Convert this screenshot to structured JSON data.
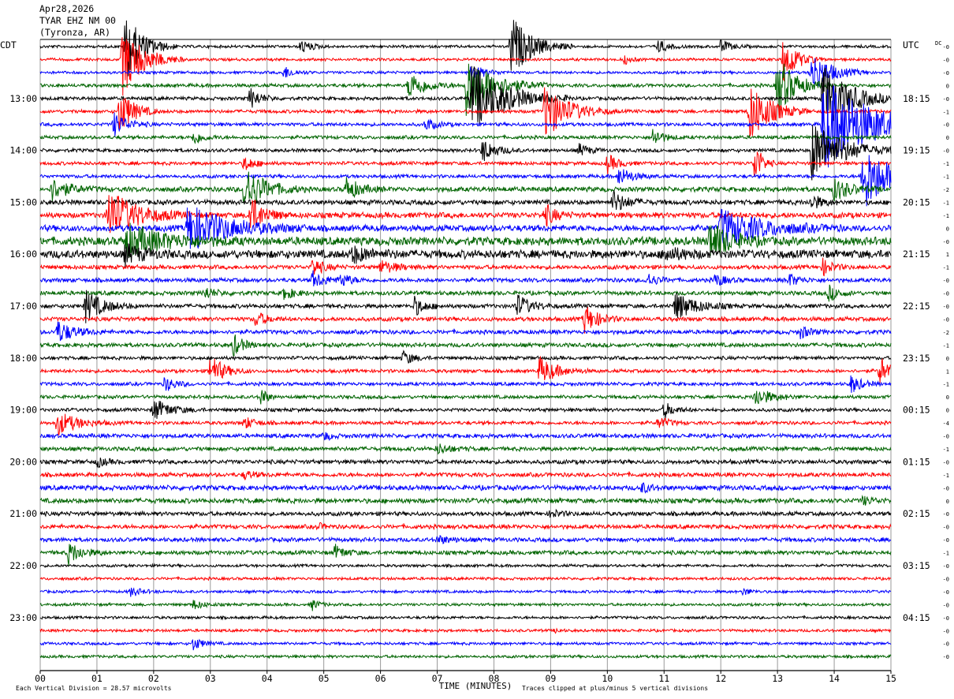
{
  "header": {
    "date": "Apr28,2026",
    "station": "TYAR EHZ NM 00",
    "location": "(Tyronza, AR)"
  },
  "chart_data": {
    "type": "line",
    "left_timezone": "CDT",
    "right_timezone": "UTC",
    "xlabel": "TIME (MINUTES)",
    "xlim": [
      0,
      15
    ],
    "x_ticks": [
      "00",
      "01",
      "02",
      "03",
      "04",
      "05",
      "06",
      "07",
      "08",
      "09",
      "10",
      "11",
      "12",
      "13",
      "14",
      "15"
    ],
    "trace_minutes": 15,
    "trace_count": 48,
    "trace_colors": [
      "#000000",
      "#ff0000",
      "#0000ff",
      "#006400"
    ],
    "cdt_labels": [
      "13:00",
      "14:00",
      "15:00",
      "16:00",
      "17:00",
      "18:00",
      "19:00",
      "20:00",
      "21:00",
      "22:00",
      "23:00"
    ],
    "cdt_label_rows": [
      4,
      8,
      12,
      16,
      20,
      24,
      28,
      32,
      36,
      40,
      44
    ],
    "utc_labels": [
      "18:15",
      "19:15",
      "20:15",
      "21:15",
      "22:15",
      "23:15",
      "00:15",
      "01:15",
      "02:15",
      "03:15",
      "04:15"
    ],
    "utc_label_rows": [
      4,
      8,
      12,
      16,
      20,
      24,
      28,
      32,
      36,
      40,
      44
    ],
    "dc_label": "DC",
    "dc_offsets": [
      "-0",
      "-0",
      "-0",
      "0",
      "-0",
      "-1",
      "-0",
      "0",
      "-0",
      "-1",
      "-1",
      "-2",
      "-1",
      "-1",
      "0",
      "-0",
      "1",
      "-1",
      "-0",
      "-0",
      "-0",
      "-0",
      "-2",
      "-1",
      "0",
      "1",
      "-1",
      "0",
      "0",
      "-4",
      "-0",
      "-1",
      "-0",
      "-1",
      "-0",
      "0",
      "-0",
      "-0",
      "-0",
      "-1",
      "-0",
      "-0",
      "-0",
      "-0",
      "-0",
      "-0",
      "-0",
      "-0"
    ],
    "trace_noise": [
      2,
      2,
      2,
      2.5,
      2.5,
      2.5,
      2.5,
      2.5,
      2.5,
      2.5,
      2.5,
      3.5,
      3.5,
      4,
      4.5,
      6,
      6,
      3,
      3,
      3,
      3,
      3,
      3,
      3,
      2.5,
      2.5,
      2.5,
      2.5,
      2.5,
      2.5,
      3,
      3,
      3,
      3,
      3.5,
      3.5,
      3,
      3,
      3,
      3,
      2,
      2,
      2,
      2,
      2,
      2,
      2,
      2
    ],
    "events": [
      {
        "row": 0,
        "minute": 1.5,
        "amplitude": 45,
        "duration": 0.5
      },
      {
        "row": 0,
        "minute": 4.6,
        "amplitude": 9,
        "duration": 0.3
      },
      {
        "row": 0,
        "minute": 8.3,
        "amplitude": 40,
        "duration": 0.6
      },
      {
        "row": 0,
        "minute": 10.9,
        "amplitude": 8,
        "duration": 0.3
      },
      {
        "row": 0,
        "minute": 12.0,
        "amplitude": 8,
        "duration": 0.3
      },
      {
        "row": 1,
        "minute": 1.45,
        "amplitude": 45,
        "duration": 0.6
      },
      {
        "row": 1,
        "minute": 10.3,
        "amplitude": 6,
        "duration": 0.2
      },
      {
        "row": 1,
        "minute": 13.1,
        "amplitude": 30,
        "duration": 0.4
      },
      {
        "row": 2,
        "minute": 4.3,
        "amplitude": 8,
        "duration": 0.3
      },
      {
        "row": 2,
        "minute": 7.6,
        "amplitude": 10,
        "duration": 0.4
      },
      {
        "row": 2,
        "minute": 13.6,
        "amplitude": 25,
        "duration": 0.6
      },
      {
        "row": 3,
        "minute": 6.5,
        "amplitude": 18,
        "duration": 0.5
      },
      {
        "row": 3,
        "minute": 7.5,
        "amplitude": 40,
        "duration": 0.8
      },
      {
        "row": 3,
        "minute": 13.0,
        "amplitude": 40,
        "duration": 0.5
      },
      {
        "row": 4,
        "minute": 3.7,
        "amplitude": 14,
        "duration": 0.3
      },
      {
        "row": 4,
        "minute": 7.6,
        "amplitude": 45,
        "duration": 1.0
      },
      {
        "row": 4,
        "minute": 13.8,
        "amplitude": 45,
        "duration": 0.8
      },
      {
        "row": 5,
        "minute": 1.4,
        "amplitude": 30,
        "duration": 0.4
      },
      {
        "row": 5,
        "minute": 8.9,
        "amplitude": 35,
        "duration": 0.7
      },
      {
        "row": 5,
        "minute": 12.5,
        "amplitude": 40,
        "duration": 0.6
      },
      {
        "row": 6,
        "minute": 1.3,
        "amplitude": 15,
        "duration": 0.4
      },
      {
        "row": 6,
        "minute": 6.8,
        "amplitude": 8,
        "duration": 0.3
      },
      {
        "row": 6,
        "minute": 13.8,
        "amplitude": 60,
        "duration": 1.5
      },
      {
        "row": 7,
        "minute": 2.7,
        "amplitude": 9,
        "duration": 0.3
      },
      {
        "row": 7,
        "minute": 10.8,
        "amplitude": 12,
        "duration": 0.3
      },
      {
        "row": 8,
        "minute": 7.8,
        "amplitude": 15,
        "duration": 0.4
      },
      {
        "row": 8,
        "minute": 9.5,
        "amplitude": 8,
        "duration": 0.3
      },
      {
        "row": 8,
        "minute": 13.6,
        "amplitude": 40,
        "duration": 0.9
      },
      {
        "row": 9,
        "minute": 3.6,
        "amplitude": 10,
        "duration": 0.3
      },
      {
        "row": 9,
        "minute": 10.0,
        "amplitude": 12,
        "duration": 0.3
      },
      {
        "row": 9,
        "minute": 12.6,
        "amplitude": 30,
        "duration": 0.2
      },
      {
        "row": 10,
        "minute": 10.2,
        "amplitude": 12,
        "duration": 0.4
      },
      {
        "row": 10,
        "minute": 14.5,
        "amplitude": 45,
        "duration": 0.8
      },
      {
        "row": 11,
        "minute": 0.2,
        "amplitude": 14,
        "duration": 0.5
      },
      {
        "row": 11,
        "minute": 3.6,
        "amplitude": 30,
        "duration": 0.6
      },
      {
        "row": 11,
        "minute": 5.4,
        "amplitude": 14,
        "duration": 0.4
      },
      {
        "row": 11,
        "minute": 14.0,
        "amplitude": 14,
        "duration": 0.5
      },
      {
        "row": 12,
        "minute": 10.1,
        "amplitude": 14,
        "duration": 0.4
      },
      {
        "row": 12,
        "minute": 13.6,
        "amplitude": 10,
        "duration": 0.3
      },
      {
        "row": 13,
        "minute": 1.2,
        "amplitude": 35,
        "duration": 0.8
      },
      {
        "row": 13,
        "minute": 3.7,
        "amplitude": 25,
        "duration": 0.4
      },
      {
        "row": 13,
        "minute": 8.9,
        "amplitude": 14,
        "duration": 0.3
      },
      {
        "row": 14,
        "minute": 2.6,
        "amplitude": 30,
        "duration": 1.2
      },
      {
        "row": 14,
        "minute": 12.0,
        "amplitude": 25,
        "duration": 1.2
      },
      {
        "row": 15,
        "minute": 1.5,
        "amplitude": 20,
        "duration": 1.2
      },
      {
        "row": 15,
        "minute": 11.8,
        "amplitude": 25,
        "duration": 0.6
      },
      {
        "row": 16,
        "minute": 1.5,
        "amplitude": 12,
        "duration": 0.5
      },
      {
        "row": 16,
        "minute": 5.5,
        "amplitude": 10,
        "duration": 0.5
      },
      {
        "row": 16,
        "minute": 11.0,
        "amplitude": 9,
        "duration": 0.5
      },
      {
        "row": 17,
        "minute": 4.8,
        "amplitude": 12,
        "duration": 0.3
      },
      {
        "row": 17,
        "minute": 6.0,
        "amplitude": 8,
        "duration": 0.5
      },
      {
        "row": 17,
        "minute": 13.8,
        "amplitude": 10,
        "duration": 0.3
      },
      {
        "row": 18,
        "minute": 4.8,
        "amplitude": 10,
        "duration": 0.4
      },
      {
        "row": 18,
        "minute": 5.3,
        "amplitude": 8,
        "duration": 0.3
      },
      {
        "row": 18,
        "minute": 10.7,
        "amplitude": 9,
        "duration": 0.3
      },
      {
        "row": 18,
        "minute": 11.9,
        "amplitude": 8,
        "duration": 0.3
      },
      {
        "row": 18,
        "minute": 13.2,
        "amplitude": 8,
        "duration": 0.3
      },
      {
        "row": 19,
        "minute": 2.9,
        "amplitude": 8,
        "duration": 0.3
      },
      {
        "row": 19,
        "minute": 4.3,
        "amplitude": 8,
        "duration": 0.3
      },
      {
        "row": 19,
        "minute": 13.9,
        "amplitude": 10,
        "duration": 0.3
      },
      {
        "row": 20,
        "minute": 0.8,
        "amplitude": 20,
        "duration": 0.5
      },
      {
        "row": 20,
        "minute": 6.6,
        "amplitude": 12,
        "duration": 0.3
      },
      {
        "row": 20,
        "minute": 8.4,
        "amplitude": 15,
        "duration": 0.4
      },
      {
        "row": 20,
        "minute": 11.2,
        "amplitude": 18,
        "duration": 0.6
      },
      {
        "row": 21,
        "minute": 3.8,
        "amplitude": 10,
        "duration": 0.3
      },
      {
        "row": 21,
        "minute": 9.6,
        "amplitude": 18,
        "duration": 0.4
      },
      {
        "row": 22,
        "minute": 0.3,
        "amplitude": 14,
        "duration": 0.5
      },
      {
        "row": 22,
        "minute": 13.4,
        "amplitude": 8,
        "duration": 0.3
      },
      {
        "row": 23,
        "minute": 3.4,
        "amplitude": 14,
        "duration": 0.3
      },
      {
        "row": 24,
        "minute": 6.4,
        "amplitude": 9,
        "duration": 0.3
      },
      {
        "row": 25,
        "minute": 3.0,
        "amplitude": 20,
        "duration": 0.4
      },
      {
        "row": 25,
        "minute": 8.8,
        "amplitude": 18,
        "duration": 0.5
      },
      {
        "row": 25,
        "minute": 14.8,
        "amplitude": 18,
        "duration": 0.3
      },
      {
        "row": 26,
        "minute": 2.2,
        "amplitude": 10,
        "duration": 0.3
      },
      {
        "row": 26,
        "minute": 14.3,
        "amplitude": 12,
        "duration": 0.3
      },
      {
        "row": 27,
        "minute": 3.9,
        "amplitude": 14,
        "duration": 0.15
      },
      {
        "row": 27,
        "minute": 12.6,
        "amplitude": 12,
        "duration": 0.5
      },
      {
        "row": 28,
        "minute": 2.0,
        "amplitude": 14,
        "duration": 0.5
      },
      {
        "row": 28,
        "minute": 11.0,
        "amplitude": 10,
        "duration": 0.3
      },
      {
        "row": 29,
        "minute": 0.3,
        "amplitude": 15,
        "duration": 0.6
      },
      {
        "row": 29,
        "minute": 3.6,
        "amplitude": 8,
        "duration": 0.3
      },
      {
        "row": 29,
        "minute": 10.9,
        "amplitude": 8,
        "duration": 0.3
      },
      {
        "row": 30,
        "minute": 5.0,
        "amplitude": 6,
        "duration": 0.2
      },
      {
        "row": 31,
        "minute": 7.0,
        "amplitude": 6,
        "duration": 0.4
      },
      {
        "row": 32,
        "minute": 1.0,
        "amplitude": 6,
        "duration": 0.3
      },
      {
        "row": 33,
        "minute": 3.6,
        "amplitude": 5,
        "duration": 0.3
      },
      {
        "row": 34,
        "minute": 10.6,
        "amplitude": 6,
        "duration": 0.3
      },
      {
        "row": 35,
        "minute": 14.5,
        "amplitude": 5,
        "duration": 0.3
      },
      {
        "row": 36,
        "minute": 9.0,
        "amplitude": 5,
        "duration": 0.3
      },
      {
        "row": 37,
        "minute": 4.9,
        "amplitude": 4,
        "duration": 0.2
      },
      {
        "row": 38,
        "minute": 7.0,
        "amplitude": 5,
        "duration": 0.4
      },
      {
        "row": 39,
        "minute": 0.5,
        "amplitude": 14,
        "duration": 0.4
      },
      {
        "row": 39,
        "minute": 5.2,
        "amplitude": 9,
        "duration": 0.3
      },
      {
        "row": 42,
        "minute": 1.6,
        "amplitude": 6,
        "duration": 0.3
      },
      {
        "row": 42,
        "minute": 12.4,
        "amplitude": 5,
        "duration": 0.2
      },
      {
        "row": 43,
        "minute": 2.7,
        "amplitude": 6,
        "duration": 0.3
      },
      {
        "row": 43,
        "minute": 4.8,
        "amplitude": 7,
        "duration": 0.2
      },
      {
        "row": 45,
        "minute": 9.1,
        "amplitude": 4,
        "duration": 0.1
      },
      {
        "row": 46,
        "minute": 2.7,
        "amplitude": 8,
        "duration": 0.3
      }
    ]
  },
  "footer": {
    "scale_note": "Each Vertical Division = 28.57 microvolts",
    "clip_note": "Traces clipped at plus/minus 5 vertical divisions"
  }
}
